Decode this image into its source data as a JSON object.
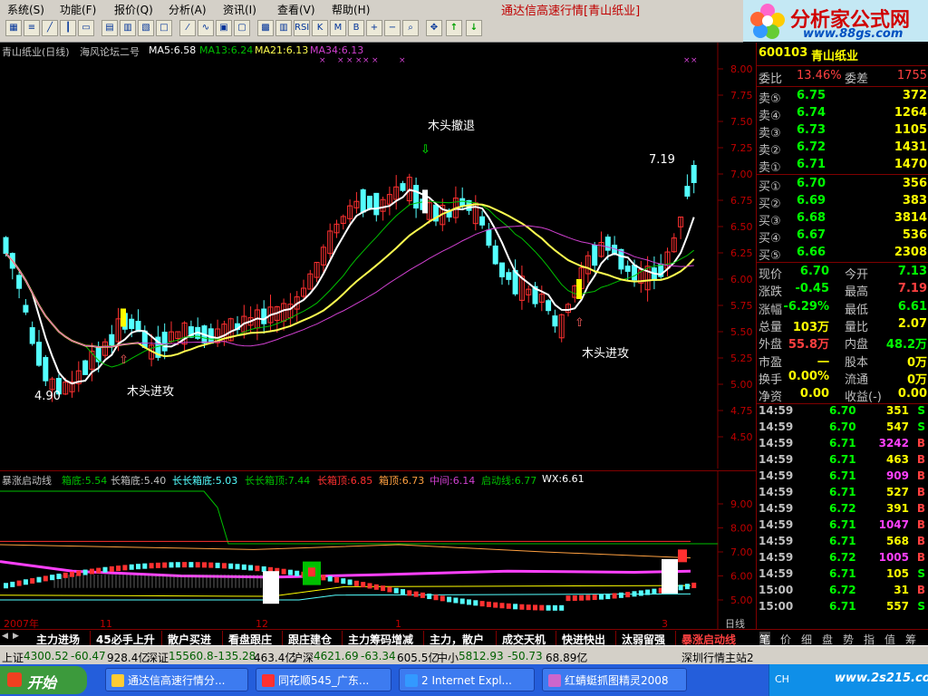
{
  "menu": [
    "系统(S)",
    "功能(F)",
    "报价(Q)",
    "分析(A)",
    "资讯(I)",
    "查看(V)",
    "帮助(H)"
  ],
  "app_title": "通达信高速行情[青山纸业]",
  "logo": {
    "name": "分析家公式网",
    "url": "www.88gs.com"
  },
  "main_chart": {
    "header": {
      "stock": "青山纸业(日线)",
      "formula": "海风论坛二号",
      "ma5": "MA5:6.58",
      "ma13": "MA13:6.24",
      "ma21": "MA21:6.13",
      "ma34": "MA34:6.13"
    },
    "yticks": [
      "8.00",
      "7.75",
      "7.50",
      "7.25",
      "7.00",
      "6.75",
      "6.50",
      "6.25",
      "6.00",
      "5.75",
      "5.50",
      "5.25",
      "5.00",
      "4.75",
      "4.50"
    ],
    "annotations": {
      "retreat": "木头撤退",
      "attack1": "木头进攻",
      "attack2": "木头进攻",
      "high": "7.19",
      "low": "4.90"
    }
  },
  "indicator": {
    "header": {
      "name": "暴涨启动线",
      "box_bottom": "箱底:5.54",
      "long_box_bottom": "长箱底:5.40",
      "long_box_bottom2": "长长箱底:5.03",
      "long_long_top": "长长箱顶:7.44",
      "long_top": "长箱顶:6.85",
      "top": "箱顶:6.73",
      "mid": "中间:6.14",
      "start": "启动线:6.77",
      "wx": "WX:6.61"
    },
    "yticks": [
      "9.00",
      "8.00",
      "7.00",
      "6.00",
      "5.00"
    ],
    "xlabels": {
      "year": "2007年",
      "m11": "11",
      "m12": "12",
      "m1": "1",
      "m3": "3"
    },
    "period": "日线"
  },
  "tabs": [
    "主力进场",
    "45必手上升",
    "散户买进",
    "看盘跟庄",
    "跟庄建仓",
    "主力筹码增减",
    "主力，散户",
    "成交天机",
    "快进快出",
    "汰弱留强",
    "暴涨启动线"
  ],
  "panel": {
    "code": "600103",
    "name": "青山纸业",
    "weibi_label": "委比",
    "weibi": "13.46%",
    "weicha_label": "委差",
    "weicha": "1755",
    "sells": [
      {
        "label": "卖⑤",
        "price": "6.75",
        "vol": "372"
      },
      {
        "label": "卖④",
        "price": "6.74",
        "vol": "1264"
      },
      {
        "label": "卖③",
        "price": "6.73",
        "vol": "1105"
      },
      {
        "label": "卖②",
        "price": "6.72",
        "vol": "1431"
      },
      {
        "label": "卖①",
        "price": "6.71",
        "vol": "1470"
      }
    ],
    "buys": [
      {
        "label": "买①",
        "price": "6.70",
        "vol": "356"
      },
      {
        "label": "买②",
        "price": "6.69",
        "vol": "383"
      },
      {
        "label": "买③",
        "price": "6.68",
        "vol": "3814"
      },
      {
        "label": "买④",
        "price": "6.67",
        "vol": "536"
      },
      {
        "label": "买⑤",
        "price": "6.66",
        "vol": "2308"
      }
    ],
    "stats": [
      {
        "l1": "现价",
        "v1": "6.70",
        "c1": "#00ff00",
        "l2": "今开",
        "v2": "7.13",
        "c2": "#00ff00"
      },
      {
        "l1": "涨跌",
        "v1": "-0.45",
        "c1": "#00ff00",
        "l2": "最高",
        "v2": "7.19",
        "c2": "#ff4040"
      },
      {
        "l1": "涨幅",
        "v1": "-6.29%",
        "c1": "#00ff00",
        "l2": "最低",
        "v2": "6.61",
        "c2": "#00ff00"
      },
      {
        "l1": "总量",
        "v1": "103万",
        "c1": "#ffff00",
        "l2": "量比",
        "v2": "2.07",
        "c2": "#ffff00"
      },
      {
        "l1": "外盘",
        "v1": "55.8万",
        "c1": "#ff4040",
        "l2": "内盘",
        "v2": "48.2万",
        "c2": "#00ff00"
      },
      {
        "l1": "市盈",
        "v1": "一",
        "c1": "#ffff00",
        "l2": "股本",
        "v2": "0万",
        "c2": "#ffff00"
      },
      {
        "l1": "换手",
        "v1": "0.00%",
        "c1": "#ffff00",
        "l2": "流通",
        "v2": "0万",
        "c2": "#ffff00"
      },
      {
        "l1": "净资",
        "v1": "0.00",
        "c1": "#ffff00",
        "l2": "收益(-)",
        "v2": "0.00",
        "c2": "#ffff00"
      }
    ],
    "ticks": [
      {
        "t": "14:59",
        "p": "6.70",
        "v": "351",
        "bs": "S"
      },
      {
        "t": "14:59",
        "p": "6.70",
        "v": "547",
        "bs": "S"
      },
      {
        "t": "14:59",
        "p": "6.71",
        "v": "3242",
        "bs": "B"
      },
      {
        "t": "14:59",
        "p": "6.71",
        "v": "463",
        "bs": "B"
      },
      {
        "t": "14:59",
        "p": "6.71",
        "v": "909",
        "bs": "B"
      },
      {
        "t": "14:59",
        "p": "6.71",
        "v": "527",
        "bs": "B"
      },
      {
        "t": "14:59",
        "p": "6.72",
        "v": "391",
        "bs": "B"
      },
      {
        "t": "14:59",
        "p": "6.71",
        "v": "1047",
        "bs": "B"
      },
      {
        "t": "14:59",
        "p": "6.71",
        "v": "568",
        "bs": "B"
      },
      {
        "t": "14:59",
        "p": "6.72",
        "v": "1005",
        "bs": "B"
      },
      {
        "t": "14:59",
        "p": "6.71",
        "v": "105",
        "bs": "S"
      },
      {
        "t": "15:00",
        "p": "6.72",
        "v": "31",
        "bs": "B"
      },
      {
        "t": "15:00",
        "p": "6.71",
        "v": "557",
        "bs": "S"
      }
    ],
    "tabs": [
      "笔",
      "价",
      "细",
      "盘",
      "势",
      "指",
      "值",
      "筹"
    ]
  },
  "status": {
    "sh_label": "上证",
    "sh": "4300.52",
    "sh_chg": "-60.47",
    "sh_amt": "928.4亿",
    "sz_label": "深证",
    "sz": "15560.8",
    "sz_chg": "-135.28",
    "sz_amt": "463.4亿",
    "hs_label": "沪深",
    "hs": "4621.69",
    "hs_chg": "-63.34",
    "hs_amt": "605.5亿",
    "zx_label": "中小",
    "zx": "5812.93",
    "zx_chg": "-50.73",
    "zx_amt": "68.89亿",
    "server": "深圳行情主站2"
  },
  "taskbar": {
    "start": "开始",
    "tasks": [
      "通达信高速行情分...",
      "同花顺545_广东...",
      "2 Internet Expl...",
      "红蜻蜓抓图精灵2008"
    ],
    "tray": "CH",
    "watermark": "www.2s215.com"
  },
  "colors": {
    "up": "#ff3030",
    "down": "#54ffff",
    "ma5": "#ffffff",
    "ma13": "#00c000",
    "ma21": "#ffff50",
    "ma34": "#d040d0"
  }
}
